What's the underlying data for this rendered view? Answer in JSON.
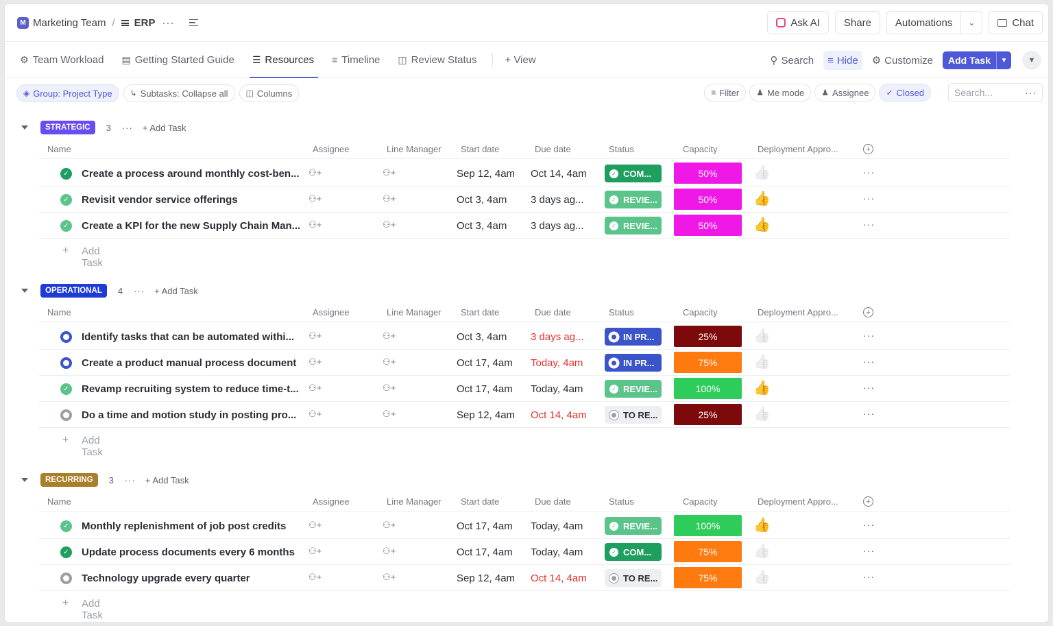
{
  "breadcrumb": {
    "workspace_initial": "M",
    "workspace": "Marketing Team",
    "separator": "/",
    "list": "ERP",
    "more": "···"
  },
  "top_actions": {
    "ask_ai": "Ask AI",
    "share": "Share",
    "automations": "Automations",
    "chat": "Chat"
  },
  "views": [
    {
      "label": "Team Workload",
      "icon": "workload-icon"
    },
    {
      "label": "Getting Started Guide",
      "icon": "doc-icon"
    },
    {
      "label": "Resources",
      "icon": "list-icon",
      "active": true
    },
    {
      "label": "Timeline",
      "icon": "timeline-icon"
    },
    {
      "label": "Review Status",
      "icon": "board-icon"
    }
  ],
  "add_view": "+ View",
  "view_actions": {
    "search": "Search",
    "hide": "Hide",
    "customize": "Customize",
    "add_task": "Add Task"
  },
  "filters": {
    "group": "Group: Project Type",
    "subtasks": "Subtasks: Collapse all",
    "columns": "Columns",
    "filter": "Filter",
    "me_mode": "Me mode",
    "assignee": "Assignee",
    "closed": "Closed",
    "search_placeholder": "Search..."
  },
  "columns": {
    "name": "Name",
    "assignee": "Assignee",
    "line_manager": "Line Manager",
    "start_date": "Start date",
    "due_date": "Due date",
    "status": "Status",
    "capacity": "Capacity",
    "deployment": "Deployment Appro..."
  },
  "add_task_label": "Add Task",
  "colors": {
    "accent": "#5b5fc7",
    "completed": "#1e9e5f",
    "review": "#5ac48a",
    "in_progress": "#3a54c9",
    "to_review": "#9aa0a8",
    "overdue": "#e4302f"
  },
  "groups": [
    {
      "name": "STRATEGIC",
      "color": "#6a4df0",
      "count": "3",
      "tasks": [
        {
          "name": "Create a process around monthly cost-ben...",
          "start": "Sep 12, 4am",
          "due": "Oct 14, 4am",
          "due_red": false,
          "status": "COM...",
          "status_type": "completed",
          "capacity": "50%",
          "cap_color": "#f018e6",
          "approved": false
        },
        {
          "name": "Revisit vendor service offerings",
          "start": "Oct 3, 4am",
          "due": "3 days ag...",
          "due_red": false,
          "status": "REVIE...",
          "status_type": "review",
          "capacity": "50%",
          "cap_color": "#f018e6",
          "approved": true
        },
        {
          "name": "Create a KPI for the new Supply Chain Man...",
          "start": "Oct 3, 4am",
          "due": "3 days ag...",
          "due_red": false,
          "status": "REVIE...",
          "status_type": "review",
          "capacity": "50%",
          "cap_color": "#f018e6",
          "approved": true
        }
      ]
    },
    {
      "name": "OPERATIONAL",
      "color": "#1d3bd6",
      "count": "4",
      "tasks": [
        {
          "name": "Identify tasks that can be automated withi...",
          "start": "Oct 3, 4am",
          "due": "3 days ag...",
          "due_red": true,
          "status": "IN PR...",
          "status_type": "in_progress",
          "capacity": "25%",
          "cap_color": "#7d0a0a",
          "approved": false
        },
        {
          "name": "Create a product manual process document",
          "start": "Oct 17, 4am",
          "due": "Today, 4am",
          "due_red": true,
          "status": "IN PR...",
          "status_type": "in_progress",
          "capacity": "75%",
          "cap_color": "#ff7a0f",
          "approved": false
        },
        {
          "name": "Revamp recruiting system to reduce time-t...",
          "start": "Oct 17, 4am",
          "due": "Today, 4am",
          "due_red": false,
          "status": "REVIE...",
          "status_type": "review",
          "capacity": "100%",
          "cap_color": "#2ecc5a",
          "approved": true
        },
        {
          "name": "Do a time and motion study in posting pro...",
          "start": "Sep 12, 4am",
          "due": "Oct 14, 4am",
          "due_red": true,
          "status": "TO RE...",
          "status_type": "to_review",
          "capacity": "25%",
          "cap_color": "#7d0a0a",
          "approved": false
        }
      ]
    },
    {
      "name": "RECURRING",
      "color": "#a97f2a",
      "count": "3",
      "tasks": [
        {
          "name": "Monthly replenishment of job post credits",
          "start": "Oct 17, 4am",
          "due": "Today, 4am",
          "due_red": false,
          "status": "REVIE...",
          "status_type": "review",
          "capacity": "100%",
          "cap_color": "#2ecc5a",
          "approved": true
        },
        {
          "name": "Update process documents every 6 months",
          "start": "Oct 17, 4am",
          "due": "Today, 4am",
          "due_red": false,
          "status": "COM...",
          "status_type": "completed",
          "capacity": "75%",
          "cap_color": "#ff7a0f",
          "approved": false
        },
        {
          "name": "Technology upgrade every quarter",
          "start": "Sep 12, 4am",
          "due": "Oct 14, 4am",
          "due_red": true,
          "status": "TO RE...",
          "status_type": "to_review",
          "capacity": "75%",
          "cap_color": "#ff7a0f",
          "approved": false
        }
      ]
    }
  ]
}
